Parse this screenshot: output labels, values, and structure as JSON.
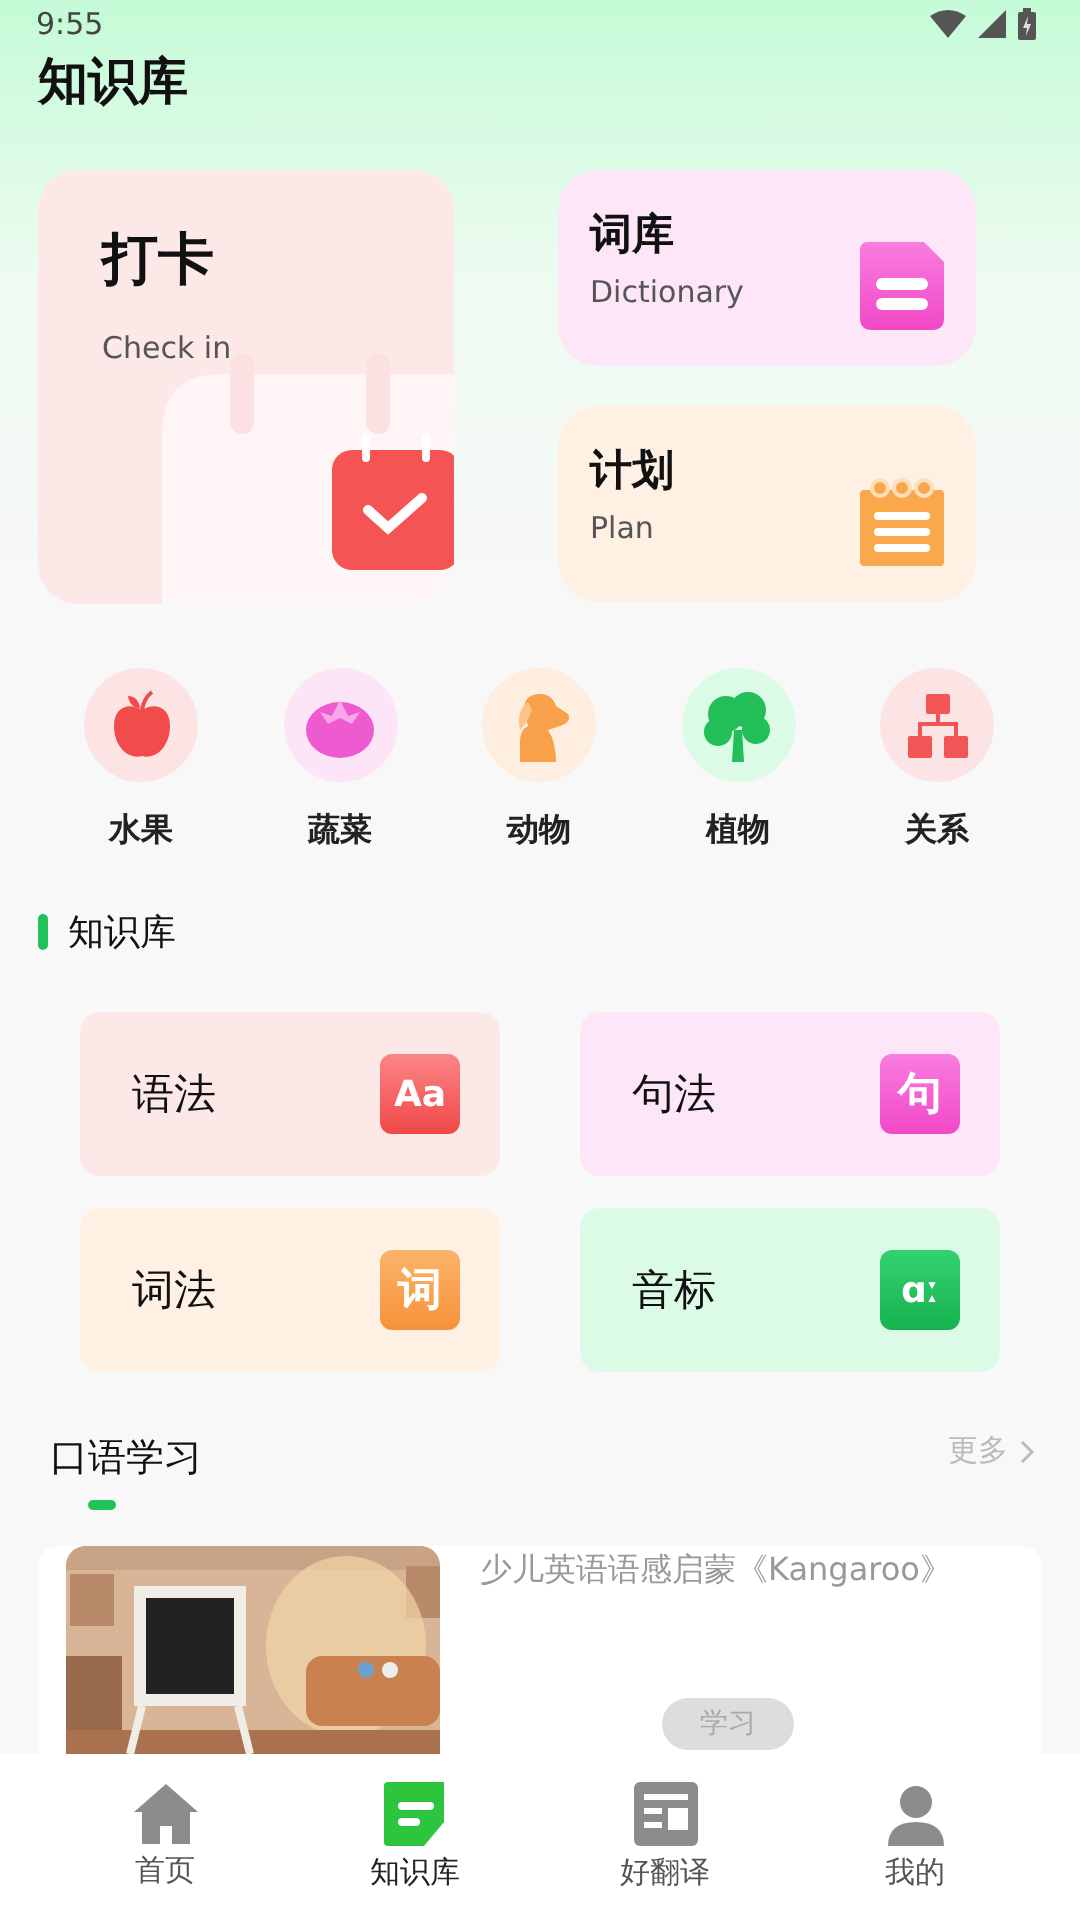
{
  "status_bar": {
    "time": "9:55"
  },
  "page_title": "知识库",
  "feature_cards": [
    {
      "kind": "checkin",
      "title": "打卡",
      "subtitle": "Check in",
      "color": "#fde8e8"
    },
    {
      "kind": "dictionary",
      "title": "词库",
      "subtitle": "Dictionary",
      "color": "#fde6f7"
    },
    {
      "kind": "plan",
      "title": "计划",
      "subtitle": "Plan",
      "color": "#fef1e4"
    }
  ],
  "categories": [
    {
      "kind": "fruit",
      "label": "水果",
      "color": "#fde4e4"
    },
    {
      "kind": "vegetable",
      "label": "蔬菜",
      "color": "#fde4f7"
    },
    {
      "kind": "animal",
      "label": "动物",
      "color": "#feeedf"
    },
    {
      "kind": "plant",
      "label": "植物",
      "color": "#dcfbe6"
    },
    {
      "kind": "relation",
      "label": "关系",
      "color": "#fde4e4"
    }
  ],
  "knowledge_section": {
    "title": "知识库",
    "items": [
      {
        "kind": "grammar",
        "label": "语法",
        "badge": "Aa",
        "color": "#fde8e8"
      },
      {
        "kind": "syntax",
        "label": "句法",
        "badge": "句",
        "color": "#fde6f7"
      },
      {
        "kind": "lexis",
        "label": "词法",
        "badge": "词",
        "color": "#fef1e4"
      },
      {
        "kind": "phonetics",
        "label": "音标",
        "badge": "ɑː",
        "color": "#dcfbe6"
      }
    ]
  },
  "speaking_section": {
    "title": "口语学习",
    "more": "更多",
    "lessons": [
      {
        "title": "少儿英语语感启蒙《Kangaroo》",
        "action": "学习"
      }
    ]
  },
  "tab_bar": [
    {
      "kind": "home",
      "label": "首页",
      "selected": false
    },
    {
      "kind": "knowledge",
      "label": "知识库",
      "selected": true
    },
    {
      "kind": "translate",
      "label": "好翻译",
      "selected": false
    },
    {
      "kind": "me",
      "label": "我的",
      "selected": false
    }
  ]
}
